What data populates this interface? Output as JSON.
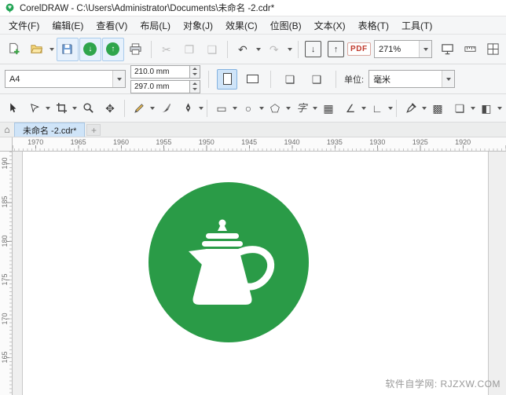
{
  "window": {
    "title": "CorelDRAW - C:\\Users\\Administrator\\Documents\\未命名 -2.cdr*"
  },
  "menu": {
    "items": [
      "文件(F)",
      "编辑(E)",
      "查看(V)",
      "布局(L)",
      "对象(J)",
      "效果(C)",
      "位图(B)",
      "文本(X)",
      "表格(T)",
      "工具(T)"
    ]
  },
  "toolbar": {
    "pdf_label": "PDF",
    "zoom_value": "271%"
  },
  "property_bar": {
    "page_size": "A4",
    "width": "210.0 mm",
    "height": "297.0 mm",
    "units_label": "单位:",
    "units_value": "毫米"
  },
  "document": {
    "tab_label": "未命名 -2.cdr*"
  },
  "icons": {
    "cut": "✂",
    "copy": "❐",
    "paste": "❑",
    "undo": "↶",
    "redo": "↷",
    "down": "↓",
    "up": "↑",
    "pan": "✥",
    "rectangle": "▭",
    "ellipse": "○",
    "polygon": "⬠",
    "text": "字",
    "table": "▦",
    "dimension": "∠",
    "connector": "∟",
    "transparency": "▩",
    "shadow": "❏",
    "fill": "◧",
    "interactive_fill": "◩",
    "outline_pen": "✒",
    "smart_fill": "◆",
    "home": "⌂",
    "plus": "+",
    "pages_all": "❏",
    "pages_one": "❑"
  },
  "rulers": {
    "horizontal": [
      "1970",
      "1965",
      "1960",
      "1955",
      "1950",
      "1945",
      "1940",
      "1935",
      "1930",
      "1925",
      "1920"
    ],
    "vertical": [
      "190",
      "185",
      "180",
      "175",
      "170",
      "165"
    ]
  },
  "canvas": {
    "logo_green": "#2a9b47"
  },
  "watermark": "软件自学网: RJZXW.COM"
}
